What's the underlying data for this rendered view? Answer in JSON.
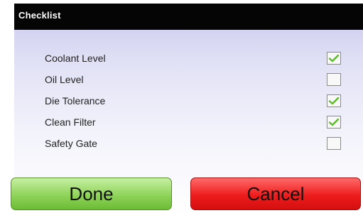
{
  "dialog": {
    "title": "Checklist"
  },
  "checklist": {
    "items": [
      {
        "label": "Coolant Level",
        "checked": true
      },
      {
        "label": "Oil Level",
        "checked": false
      },
      {
        "label": "Die Tolerance",
        "checked": true
      },
      {
        "label": "Clean Filter",
        "checked": true
      },
      {
        "label": "Safety Gate",
        "checked": false
      }
    ]
  },
  "buttons": {
    "done_label": "Done",
    "cancel_label": "Cancel"
  },
  "colors": {
    "check_mark": "#5cb82c",
    "done_button": "#8fd35a",
    "cancel_button": "#ee1c1c",
    "title_bar": "#050505"
  },
  "icons": {
    "check": "checkmark-icon"
  }
}
